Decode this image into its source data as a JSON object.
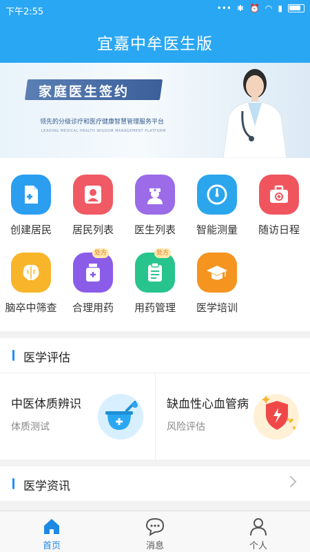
{
  "status": {
    "time": "下午2:55"
  },
  "app": {
    "title": "宜嘉中牟医生版"
  },
  "banner": {
    "headline": "家庭医生签约",
    "slogan": "领先的分级诊疗和医疗健康智慧管理服务平台",
    "english": "LEADING MEDICAL HEALTH WISDOM MANAGEMENT PLATFORM"
  },
  "grid": [
    {
      "label": "创建居民",
      "color": "#2b9ef0",
      "icon": "add-document-icon"
    },
    {
      "label": "居民列表",
      "color": "#f05a64",
      "icon": "person-icon"
    },
    {
      "label": "医生列表",
      "color": "#9b6be8",
      "icon": "nurse-icon"
    },
    {
      "label": "智能测量",
      "color": "#2ba6ec",
      "icon": "gauge-icon"
    },
    {
      "label": "随访日程",
      "color": "#f0555e",
      "icon": "medical-kit-icon"
    },
    {
      "label": "脑卒中筛查",
      "color": "#f8b52a",
      "icon": "brain-icon"
    },
    {
      "label": "合理用药",
      "color": "#8a5ce8",
      "icon": "medicine-bottle-icon",
      "tag": "处方"
    },
    {
      "label": "用药管理",
      "color": "#28c48e",
      "icon": "clipboard-icon",
      "tag": "处方"
    },
    {
      "label": "医学培训",
      "color": "#f5941f",
      "icon": "graduation-cap-icon"
    }
  ],
  "sections": {
    "evaluation": "医学评估",
    "news": "医学资讯"
  },
  "evaluations": [
    {
      "title": "中医体质辨识",
      "subtitle": "体质测试",
      "icon": "mortar-icon",
      "bg": "#d7efff"
    },
    {
      "title": "缺血性心血管病",
      "subtitle": "风险评估",
      "icon": "heart-shield-icon",
      "bg": "#fff0d6"
    }
  ],
  "tabs": [
    {
      "label": "首页",
      "icon": "home-icon",
      "active": true
    },
    {
      "label": "消息",
      "icon": "message-icon",
      "active": false
    },
    {
      "label": "个人",
      "icon": "user-icon",
      "active": false
    }
  ]
}
